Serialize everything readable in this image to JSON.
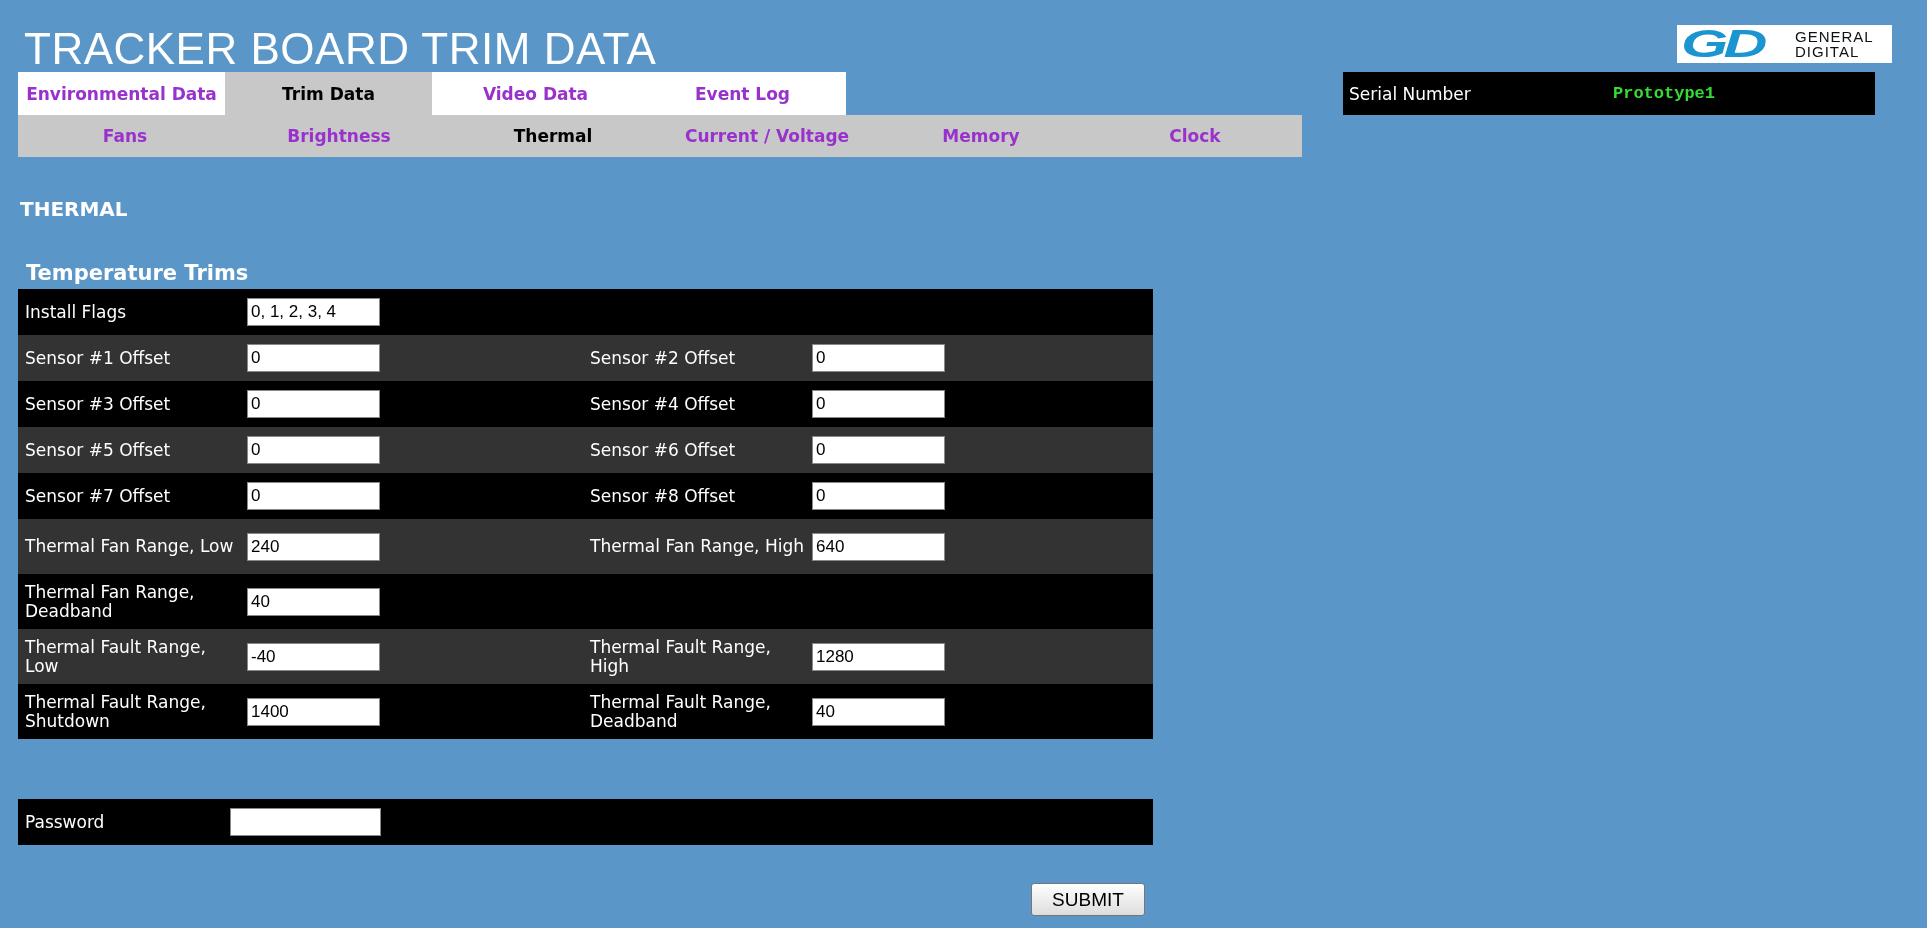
{
  "title": "TRACKER BOARD TRIM DATA",
  "logo": {
    "mark": "GD",
    "name_lines": [
      "GENERAL",
      "DIGITAL"
    ]
  },
  "tabs": [
    {
      "label": "Environmental Data",
      "selected": false
    },
    {
      "label": "Trim Data",
      "selected": true
    },
    {
      "label": "Video Data",
      "selected": false
    },
    {
      "label": "Event Log",
      "selected": false
    }
  ],
  "subtabs": [
    {
      "label": "Fans",
      "selected": false
    },
    {
      "label": "Brightness",
      "selected": false
    },
    {
      "label": "Thermal",
      "selected": true
    },
    {
      "label": "Current / Voltage",
      "selected": false
    },
    {
      "label": "Memory",
      "selected": false
    },
    {
      "label": "Clock",
      "selected": false
    }
  ],
  "serial": {
    "label": "Serial Number",
    "value": "Prototype1"
  },
  "section_title": "THERMAL",
  "group_title": "Temperature Trims",
  "rows": [
    {
      "cells": [
        {
          "label": "Install Flags",
          "value": "0, 1, 2, 3, 4"
        }
      ]
    },
    {
      "cells": [
        {
          "label": "Sensor #1 Offset",
          "value": "0"
        },
        {
          "label": "Sensor #2 Offset",
          "value": "0"
        }
      ]
    },
    {
      "cells": [
        {
          "label": "Sensor #3 Offset",
          "value": "0"
        },
        {
          "label": "Sensor #4 Offset",
          "value": "0"
        }
      ]
    },
    {
      "cells": [
        {
          "label": "Sensor #5 Offset",
          "value": "0"
        },
        {
          "label": "Sensor #6 Offset",
          "value": "0"
        }
      ]
    },
    {
      "cells": [
        {
          "label": "Sensor #7 Offset",
          "value": "0"
        },
        {
          "label": "Sensor #8 Offset",
          "value": "0"
        }
      ]
    },
    {
      "cells": [
        {
          "label": "Thermal Fan Range, Low",
          "value": "240"
        },
        {
          "label": "Thermal Fan Range, High",
          "value": "640"
        }
      ]
    },
    {
      "cells": [
        {
          "label": "Thermal Fan Range, Deadband",
          "value": "40"
        }
      ]
    },
    {
      "cells": [
        {
          "label": "Thermal Fault Range, Low",
          "value": "-40"
        },
        {
          "label": "Thermal Fault Range, High",
          "value": "1280"
        }
      ]
    },
    {
      "cells": [
        {
          "label": "Thermal Fault Range, Shutdown",
          "value": "1400"
        },
        {
          "label": "Thermal Fault Range, Deadband",
          "value": "40"
        }
      ]
    }
  ],
  "password": {
    "label": "Password"
  },
  "submit": "SUBMIT"
}
